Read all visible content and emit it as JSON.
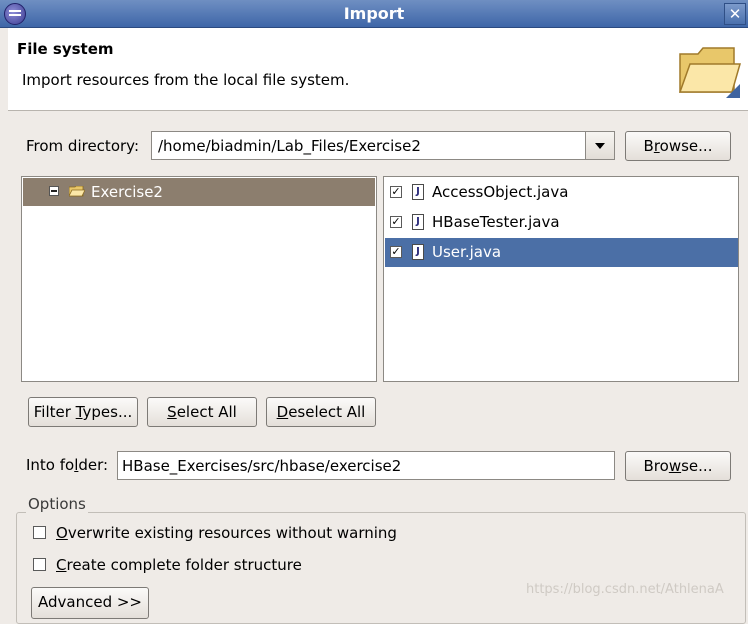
{
  "window": {
    "title": "Import",
    "close_glyph": "✕"
  },
  "header": {
    "title": "File system",
    "description": "Import resources from the local file system.",
    "icon": "folder-open-icon"
  },
  "from_directory": {
    "label": "From directory:",
    "value": "/home/biadmin/Lab_Files/Exercise2",
    "browse_label": "Browse..."
  },
  "tree": {
    "items": [
      {
        "label": "Exercise2",
        "expanded": true,
        "selected": true
      }
    ]
  },
  "files": [
    {
      "name": "AccessObject.java",
      "checked": true,
      "selected": false
    },
    {
      "name": "HBaseTester.java",
      "checked": true,
      "selected": false
    },
    {
      "name": "User.java",
      "checked": true,
      "selected": true
    }
  ],
  "buttons": {
    "filter_types": "Filter Types...",
    "select_all": "Select All",
    "deselect_all": "Deselect All",
    "advanced": "Advanced >>"
  },
  "into_folder": {
    "label": "Into folder:",
    "value": "HBase_Exercises/src/hbase/exercise2",
    "browse_label": "Browse..."
  },
  "options": {
    "group_label": "Options",
    "overwrite": {
      "label": "Overwrite existing resources without warning",
      "checked": false
    },
    "create_structure": {
      "label": "Create complete folder structure",
      "checked": false
    }
  },
  "watermark": "https://blog.csdn.net/AthlenaA",
  "colors": {
    "title_bar": "#4f74b1",
    "selection": "#4b6fa6",
    "tree_selection": "#8c7e6e",
    "dialog_bg": "#efebe7"
  }
}
